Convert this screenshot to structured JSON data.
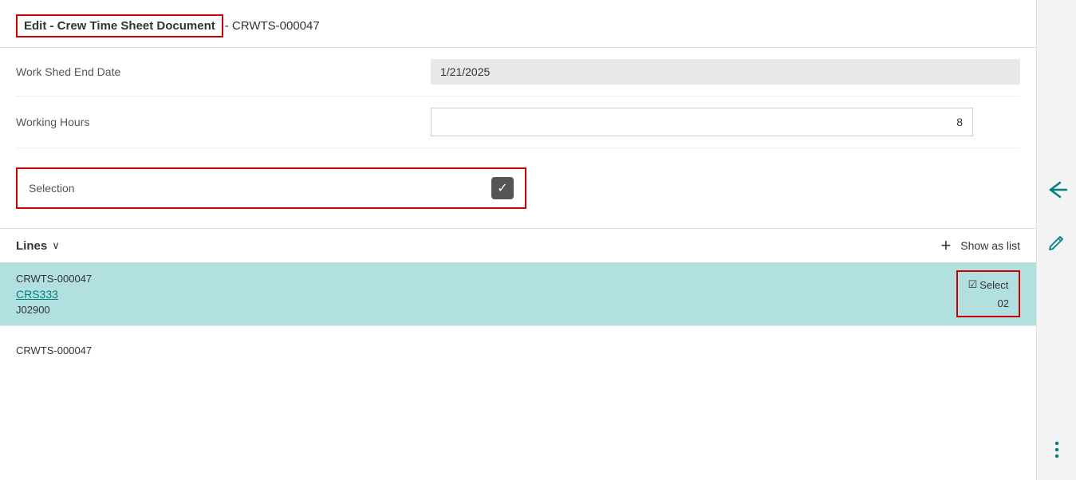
{
  "header": {
    "title_link": "Edit - Crew Time Sheet Document",
    "title_separator": " - CRWTS-000047"
  },
  "form": {
    "work_shed_end_date_label": "Work Shed End Date",
    "work_shed_end_date_value": "1/21/2025",
    "working_hours_label": "Working Hours",
    "working_hours_value": "8",
    "selection_label": "Selection",
    "selection_checked": true
  },
  "lines_section": {
    "title": "Lines",
    "chevron": "∨",
    "add_button": "+",
    "show_as_list": "Show as list"
  },
  "lines": [
    {
      "doc_num": "CRWTS-000047",
      "link": "CRS333",
      "job": "J02900",
      "select_checked": true,
      "select_label": "Select",
      "line_number": "02"
    },
    {
      "doc_num": "CRWTS-000047",
      "link": "",
      "job": "",
      "select_checked": false,
      "select_label": "",
      "line_number": ""
    }
  ],
  "sidebar": {
    "back_arrow_label": "back-arrow",
    "pencil_label": "edit-pencil",
    "three_dots_label": "more-options"
  },
  "colors": {
    "teal": "#008080",
    "highlight_bg": "#b2e0e0",
    "red_border": "#cc0000"
  }
}
